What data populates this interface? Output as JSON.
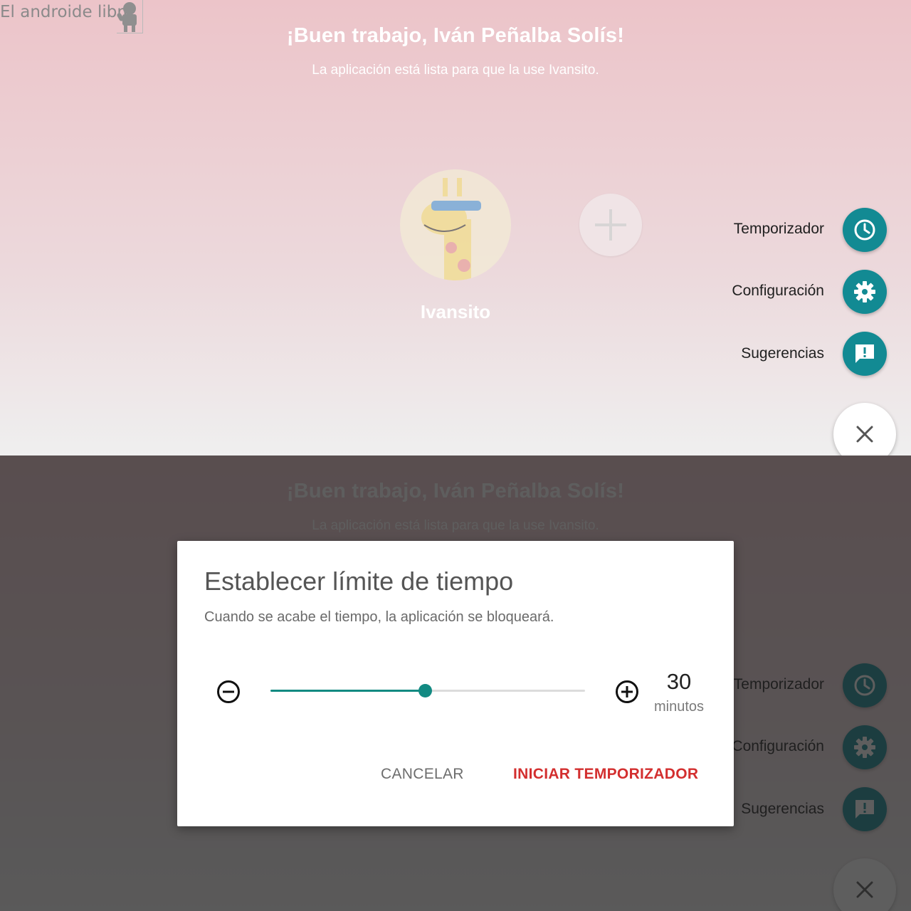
{
  "watermark": "El androide libre",
  "screen": {
    "headline": "¡Buen trabajo, Iván Peñalba Solís!",
    "subline": "La aplicación está lista para que la use Ivansito.",
    "child_name": "Ivansito"
  },
  "fab_menu": {
    "items": [
      {
        "label": "Temporizador",
        "icon": "clock-icon"
      },
      {
        "label": "Configuración",
        "icon": "gear-icon"
      },
      {
        "label": "Sugerencias",
        "icon": "feedback-icon"
      }
    ],
    "close_icon": "close-icon"
  },
  "dialog": {
    "title": "Establecer límite de tiempo",
    "message": "Cuando se acabe el tiempo, la aplicación se bloqueará.",
    "value": "30",
    "unit": "minutos",
    "slider_fraction": 0.49,
    "cancel_label": "CANCELAR",
    "start_label": "INICIAR TEMPORIZADOR"
  },
  "colors": {
    "accent": "#128a93",
    "slider": "#128a82",
    "start_button": "#d32f2f"
  }
}
